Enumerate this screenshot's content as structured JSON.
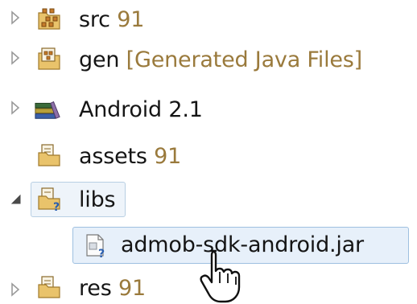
{
  "tree": {
    "items": [
      {
        "name": "src",
        "decoration": " 91",
        "expander": "collapsed",
        "icon": "source-folder-package-icon"
      },
      {
        "name": "gen",
        "decoration": " [Generated Java Files]",
        "expander": "collapsed",
        "icon": "generated-source-folder-icon"
      },
      {
        "name": "Android 2.1",
        "decoration": "",
        "expander": "collapsed",
        "icon": "library-books-icon"
      },
      {
        "name": "assets",
        "decoration": " 91",
        "expander": "none",
        "icon": "folder-icon"
      },
      {
        "name": "libs",
        "decoration": "",
        "expander": "expanded",
        "icon": "unversioned-folder-icon"
      },
      {
        "name": "admob-sdk-android.jar",
        "decoration": "",
        "expander": "none",
        "icon": "unversioned-file-icon"
      },
      {
        "name": "res",
        "decoration": " 91",
        "expander": "collapsed",
        "icon": "folder-icon"
      }
    ]
  },
  "colors": {
    "decoration_text": "#9a7a3c",
    "selection_border": "#9ec0e0",
    "selection_fill": "#e7f0fa",
    "expander": "#9a9a9a"
  },
  "cursor": {
    "icon": "hand-pointer-cursor-icon"
  }
}
